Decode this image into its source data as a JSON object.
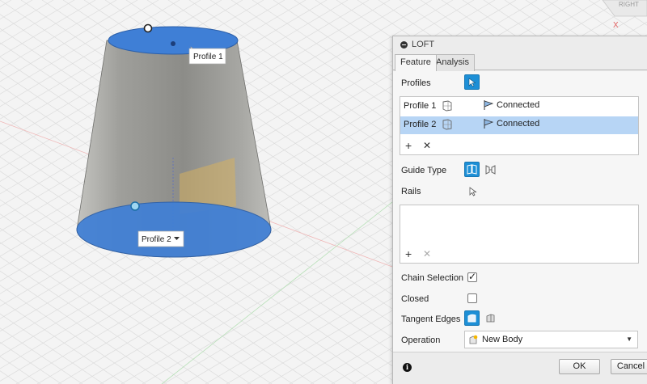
{
  "viewport": {
    "viewcube_label": "RIGHT",
    "axis_label": "X",
    "profile1_tag": "Profile 1",
    "profile2_tag": "Profile 2"
  },
  "dialog": {
    "title": "LOFT",
    "tabs": [
      {
        "label": "Feature",
        "active": true
      },
      {
        "label": "Analysis",
        "active": false
      }
    ],
    "profiles_label": "Profiles",
    "profiles": [
      {
        "name": "Profile 1",
        "status": "Connected",
        "selected": false
      },
      {
        "name": "Profile 2",
        "status": "Connected",
        "selected": true
      }
    ],
    "guide_type_label": "Guide Type",
    "rails_label": "Rails",
    "chain_selection_label": "Chain Selection",
    "chain_selection_checked": true,
    "closed_label": "Closed",
    "closed_checked": false,
    "tangent_edges_label": "Tangent Edges",
    "operation_label": "Operation",
    "operation_value": "New Body",
    "ok_label": "OK",
    "cancel_label": "Cancel"
  },
  "colors": {
    "accent": "#1d8fd6",
    "selection": "#b7d5f5",
    "profile_face": "#3f7fd6",
    "body_grey": "#a9a9a6"
  }
}
